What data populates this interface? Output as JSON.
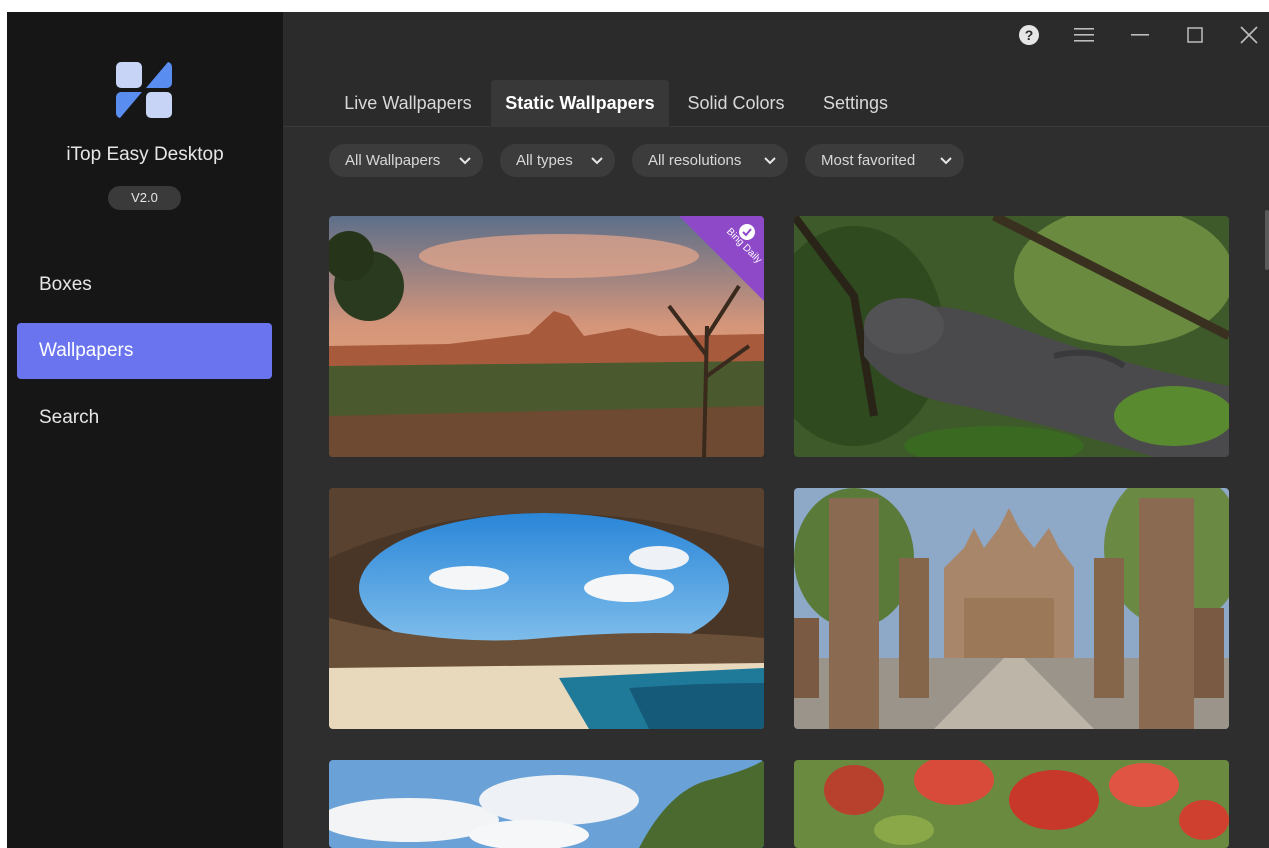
{
  "app": {
    "name": "iTop Easy Desktop",
    "version": "V2.0"
  },
  "sidebar": {
    "items": [
      {
        "label": "Boxes"
      },
      {
        "label": "Wallpapers"
      },
      {
        "label": "Search"
      }
    ]
  },
  "tabs": [
    {
      "label": "Live Wallpapers"
    },
    {
      "label": "Static Wallpapers"
    },
    {
      "label": "Solid Colors"
    },
    {
      "label": "Settings"
    }
  ],
  "filters": [
    {
      "label": "All Wallpapers"
    },
    {
      "label": "All types"
    },
    {
      "label": "All resolutions"
    },
    {
      "label": "Most favorited"
    }
  ],
  "badges": {
    "bing": "Bing Daily"
  },
  "colors": {
    "accent": "#6a74ee",
    "sidebar_bg": "#161616",
    "content_bg": "#2e2e2e",
    "bing_badge": "#8e49c9"
  },
  "icons": {
    "help": "?",
    "menu": "menu-icon",
    "minimize": "minimize-icon",
    "maximize": "maximize-icon",
    "close": "close-icon"
  }
}
